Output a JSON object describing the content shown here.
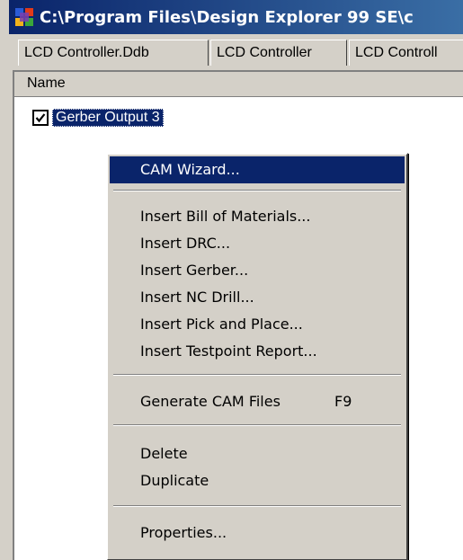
{
  "window": {
    "title": "C:\\Program Files\\Design Explorer 99 SE\\c",
    "icon": "design-explorer-app-icon"
  },
  "tabs": [
    {
      "label": "LCD Controller.Ddb"
    },
    {
      "label": "LCD Controller"
    },
    {
      "label": "LCD Controll"
    }
  ],
  "tree": {
    "column_header": "Name",
    "item": {
      "label": "Gerber Output 3",
      "checked": true
    }
  },
  "context_menu": {
    "items": [
      {
        "label": "CAM Wizard...",
        "highlighted": true
      },
      {
        "label": "Insert Bill of Materials..."
      },
      {
        "label": "Insert DRC..."
      },
      {
        "label": "Insert Gerber..."
      },
      {
        "label": "Insert NC Drill..."
      },
      {
        "label": "Insert Pick and Place..."
      },
      {
        "label": "Insert Testpoint Report..."
      },
      {
        "label": "Generate CAM Files",
        "shortcut": "F9"
      },
      {
        "label": "Delete"
      },
      {
        "label": "Duplicate"
      },
      {
        "label": "Properties..."
      }
    ]
  },
  "colors": {
    "titlebar": "#0a246a",
    "highlight": "#0a246a",
    "face": "#d4d0c8"
  }
}
